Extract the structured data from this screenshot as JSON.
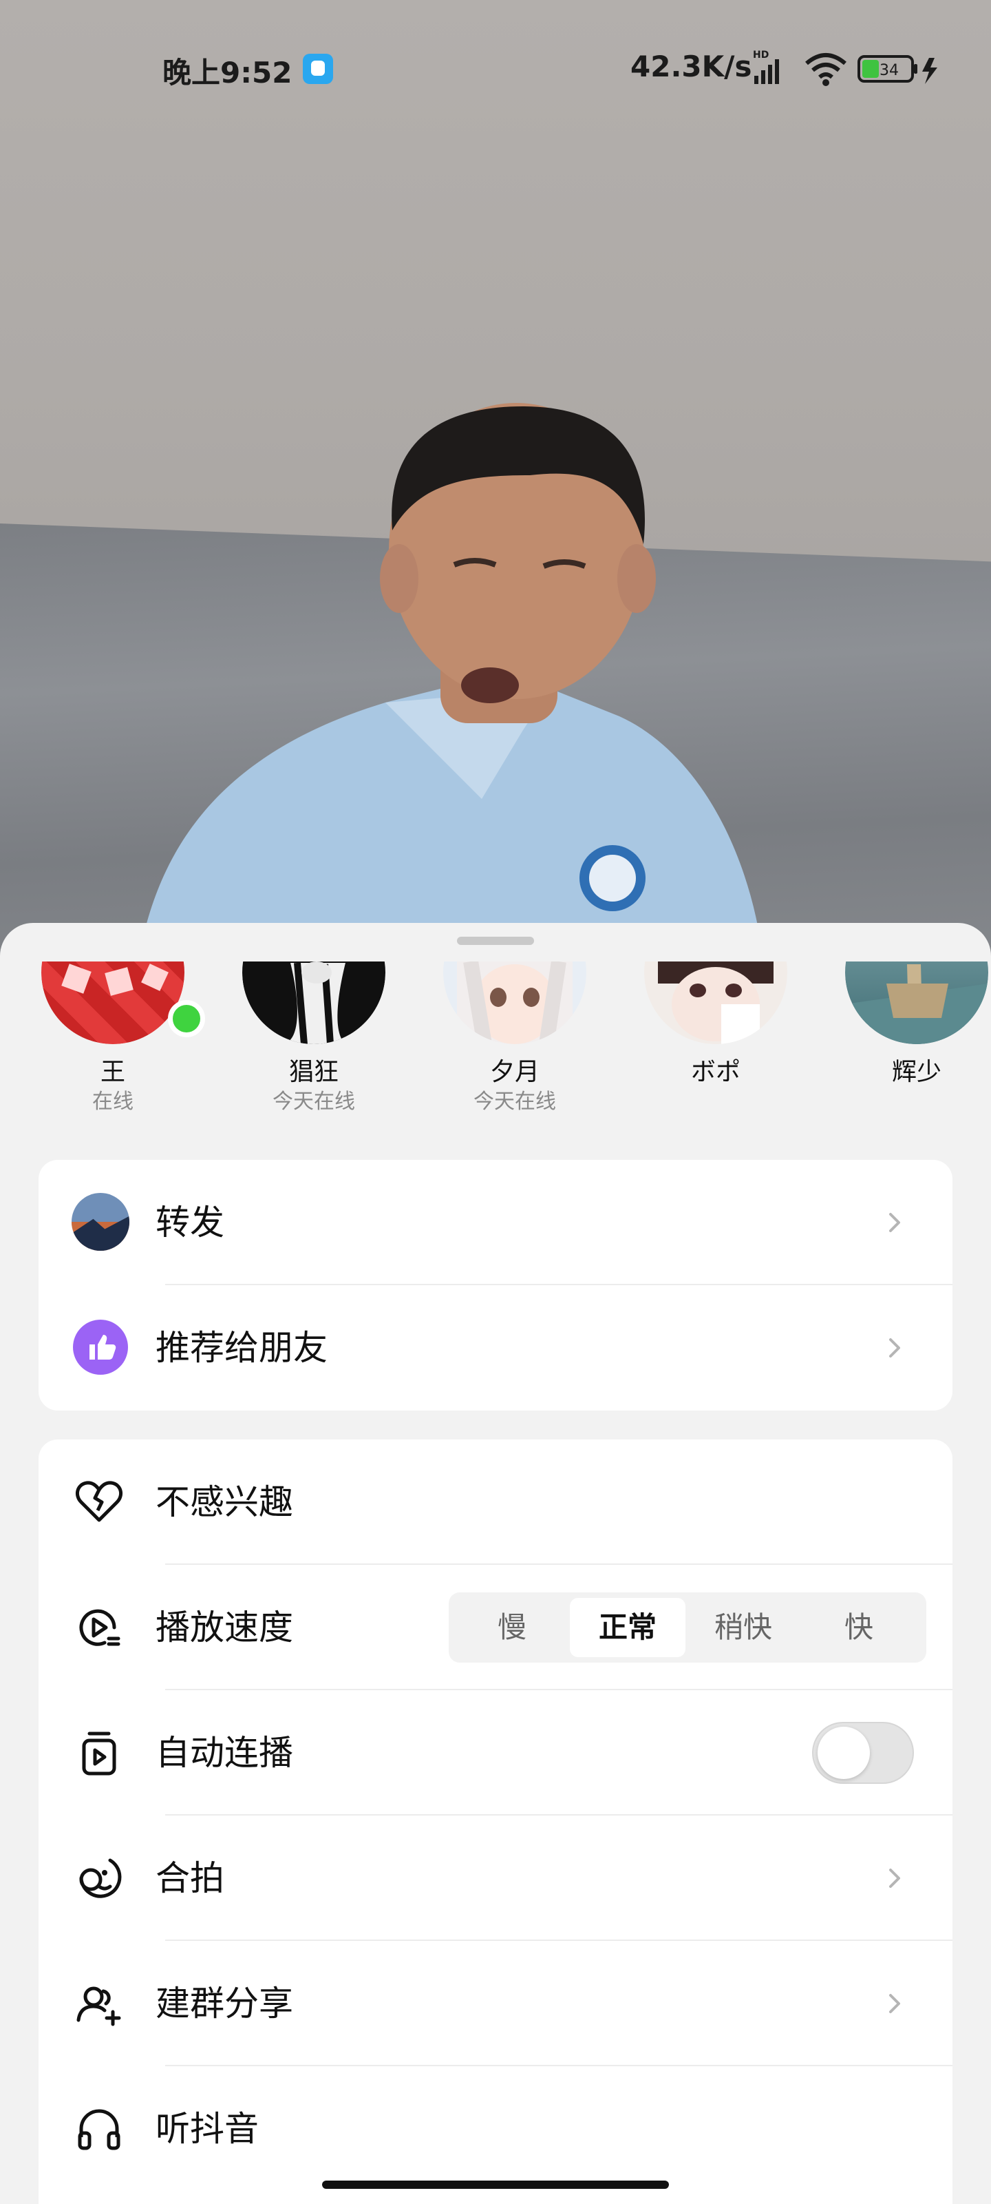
{
  "status_bar": {
    "time": "晚上9:52",
    "network_speed": "42.3K/s",
    "network_tag": "HD",
    "battery": "34"
  },
  "share_contacts": [
    {
      "name": "王",
      "status": "在线",
      "online": true,
      "avatar": "red-fu-pattern"
    },
    {
      "name": "猖狂",
      "status": "今天在线",
      "online": false,
      "avatar": "manga-girl"
    },
    {
      "name": "夕月",
      "status": "今天在线",
      "online": false,
      "avatar": "anime-white-hair"
    },
    {
      "name": "ボポ",
      "status": "",
      "online": false,
      "avatar": "anime-boy"
    },
    {
      "name": "辉少",
      "status": "",
      "online": false,
      "avatar": "ship-sea"
    }
  ],
  "share_card": {
    "items": [
      {
        "label": "转发",
        "icon": "forward-avatar-icon"
      },
      {
        "label": "推荐给朋友",
        "icon": "thumbs-up-icon"
      }
    ]
  },
  "settings_card": {
    "not_interested": "不感兴趣",
    "playback_speed": {
      "label": "播放速度",
      "options": [
        "慢",
        "正常",
        "稍快",
        "快"
      ],
      "selected": "正常"
    },
    "autoplay": {
      "label": "自动连播",
      "enabled": false
    },
    "duet": "合拍",
    "group_share": "建群分享",
    "listen": "听抖音"
  },
  "colors": {
    "accent_purple": "#9b63f5",
    "online_green": "#3fd33f"
  }
}
